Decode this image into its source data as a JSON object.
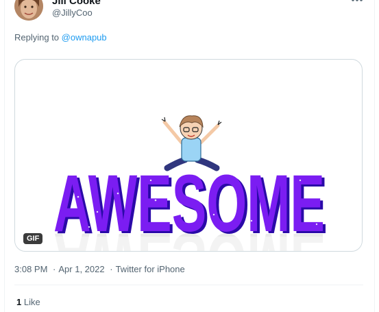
{
  "tweet": {
    "author_name": "Jill Cooke",
    "author_handle": "@JillyCoo",
    "replying_to_prefix": "Replying to",
    "replying_to_handle": "@ownapub",
    "media": {
      "badge": "GIF",
      "artwork_text": "AWESOME",
      "reflection_text": "AWESOME",
      "colors": {
        "letters": "#7b1df2",
        "letters_shadow": "#2a0aa8"
      }
    },
    "timestamp_time": "3:08 PM",
    "separator": "·",
    "timestamp_date": "Apr 1, 2022",
    "source": "Twitter for iPhone",
    "likes_count": "1",
    "likes_label": "Like"
  },
  "colors": {
    "text_primary": "#0f1419",
    "text_secondary": "#536471",
    "link": "#1d9bf0",
    "border": "#cfd9de"
  },
  "icons": {
    "more": "more-horizontal-icon"
  }
}
